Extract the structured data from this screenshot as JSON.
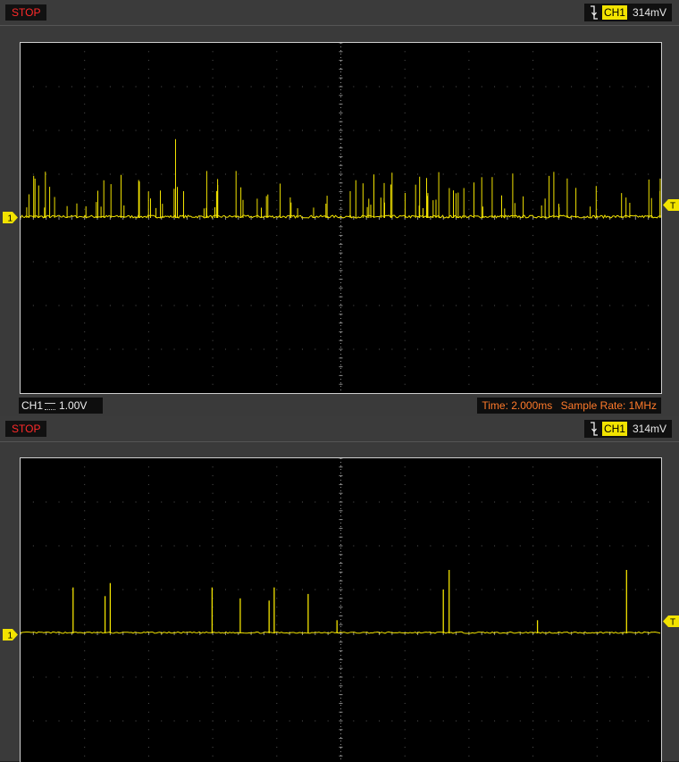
{
  "panels": [
    {
      "status": "STOP",
      "trigger": {
        "channel": "CH1",
        "level": "314mV"
      },
      "channel_marker": "1",
      "trigger_marker": "T",
      "bottom": {
        "channel": "CH1",
        "coupling_icon": "dc-coupling-icon",
        "volts_per_div": "1.00V",
        "time": "Time: 2.000ms",
        "sample_rate": "Sample Rate: 1MHz"
      }
    },
    {
      "status": "STOP",
      "trigger": {
        "channel": "CH1",
        "level": "314mV"
      },
      "channel_marker": "1",
      "trigger_marker": "T"
    }
  ],
  "colors": {
    "trace": "#f2e300",
    "stop_text": "#ff2a2a",
    "info_text": "#ff7a2a",
    "grid": "#8a8a8a",
    "screen_bg": "#000000"
  },
  "chart_data": [
    {
      "type": "line",
      "grid": true,
      "grid_divisions": {
        "x": 10,
        "y": 8
      },
      "baseline_div": 4,
      "description_series": "dense spiky trace",
      "seed": 7,
      "spike_count": 110,
      "spike_max_div": 1.8
    },
    {
      "type": "line",
      "grid": true,
      "grid_divisions": {
        "x": 10,
        "y": 8
      },
      "baseline_div": 4,
      "spikes": [
        {
          "x_div": 0.82,
          "h_div": 1.05
        },
        {
          "x_div": 1.32,
          "h_div": 0.85
        },
        {
          "x_div": 1.4,
          "h_div": 1.15
        },
        {
          "x_div": 2.99,
          "h_div": 1.05
        },
        {
          "x_div": 3.43,
          "h_div": 0.8
        },
        {
          "x_div": 3.88,
          "h_div": 0.75
        },
        {
          "x_div": 3.96,
          "h_div": 1.05
        },
        {
          "x_div": 4.49,
          "h_div": 0.9
        },
        {
          "x_div": 4.94,
          "h_div": 0.3
        },
        {
          "x_div": 6.6,
          "h_div": 1.0
        },
        {
          "x_div": 6.69,
          "h_div": 1.45
        },
        {
          "x_div": 8.07,
          "h_div": 0.3
        },
        {
          "x_div": 9.46,
          "h_div": 1.45
        }
      ]
    }
  ]
}
